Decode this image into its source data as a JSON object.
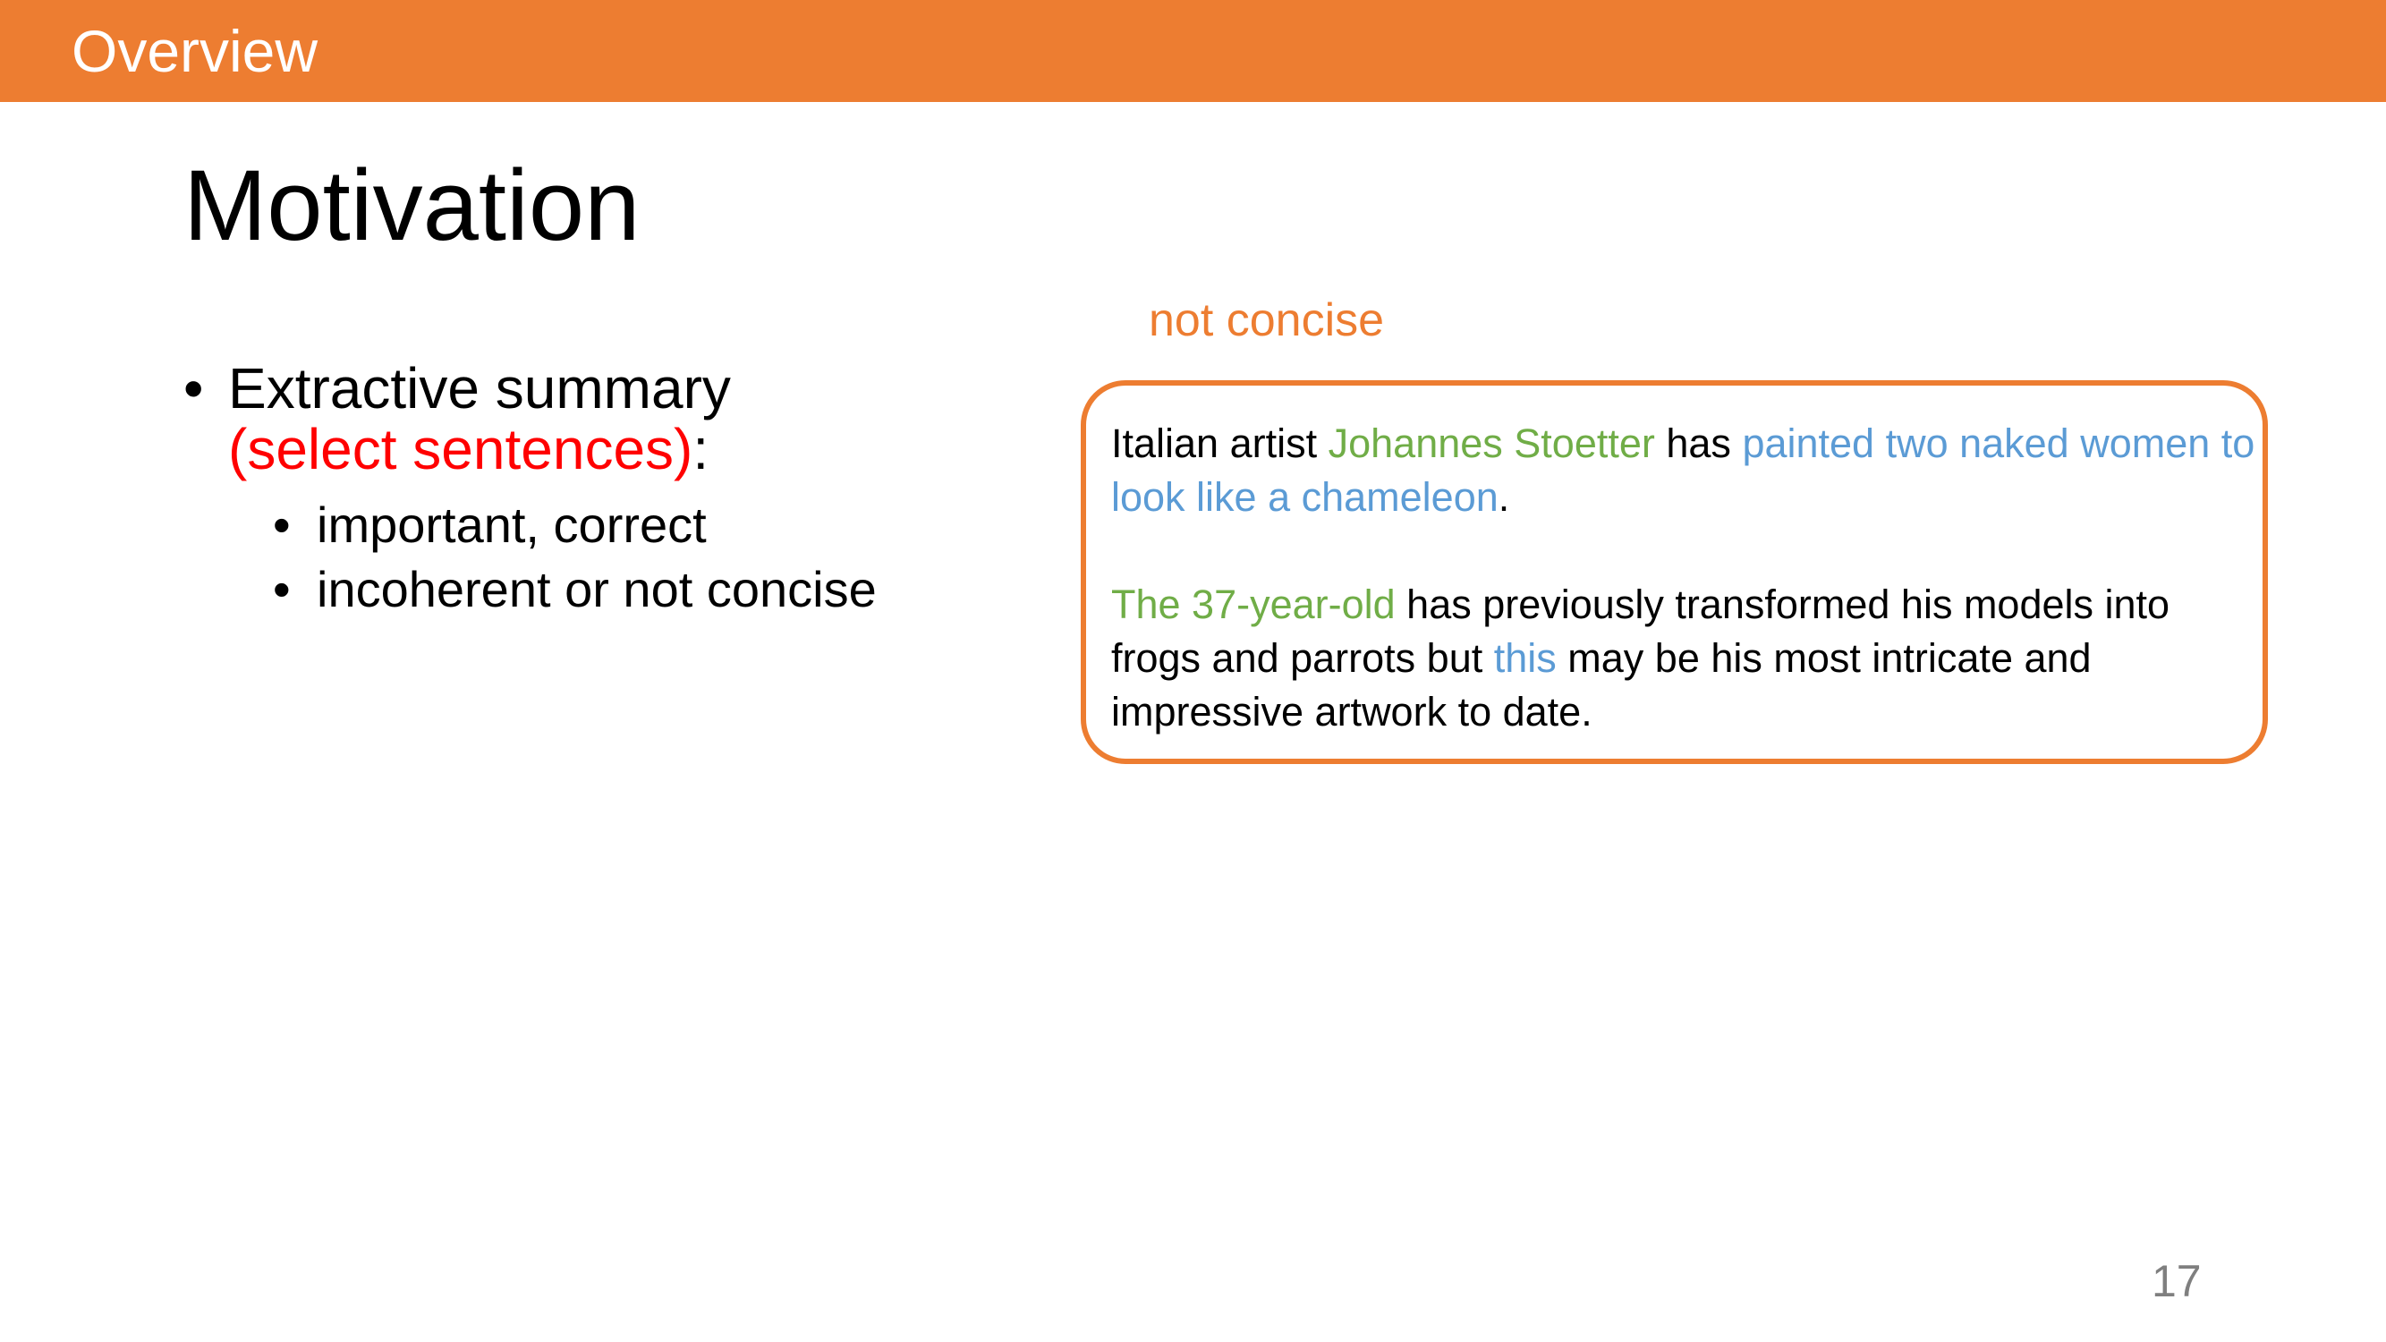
{
  "header": {
    "title": "Overview"
  },
  "slide": {
    "title": "Motivation",
    "bullet": {
      "text": "Extractive summary",
      "highlight": "(select sentences)",
      "suffix": ":",
      "sub": [
        "important, correct",
        "incoherent or not concise"
      ]
    },
    "annotation": "not concise",
    "example": {
      "s1": {
        "a": "Italian artist ",
        "b": "Johannes Stoetter",
        "c": " has ",
        "d": "painted two naked women to look like a chameleon",
        "e": "."
      },
      "s2": {
        "a": "The 37-year-old",
        "b": " has previously transformed his models into frogs and parrots but ",
        "c": "this",
        "d": " may be his most intricate and impressive artwork to date."
      }
    },
    "page_number": "17"
  },
  "colors": {
    "accent": "#ED7D31",
    "green": "#70AD47",
    "blue": "#5B9BD5",
    "red": "#FF0000"
  }
}
